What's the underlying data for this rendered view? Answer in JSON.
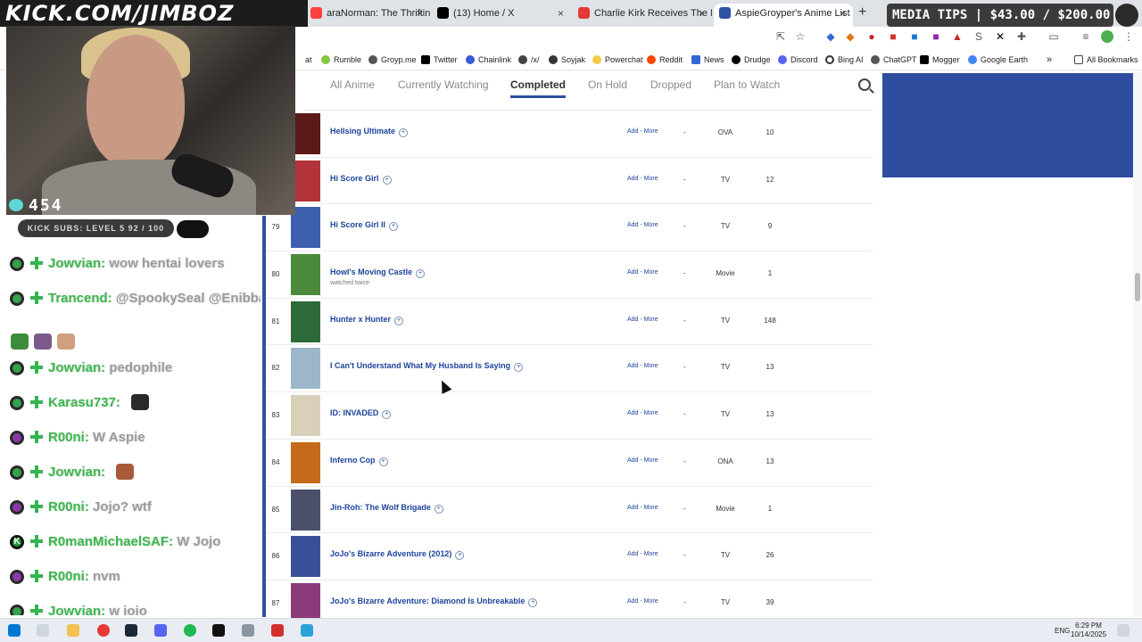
{
  "browser": {
    "tabs": [
      {
        "label": "araNorman: The Thrifting' Of",
        "color": "#ff4040",
        "active": false
      },
      {
        "label": "(13) Home / X",
        "color": "#000000",
        "active": false
      },
      {
        "label": "Charlie Kirk Receives The M",
        "color": "#e53935",
        "active": false
      },
      {
        "label": "AspieGroyper's Anime List - My",
        "color": "#2e51a2",
        "active": true
      }
    ],
    "new_tab": "+",
    "bookmarks": [
      "at",
      "Rumble",
      "Groyp.me",
      "Twitter",
      "Chainlink",
      "/x/",
      "Soyjak",
      "Powerchat",
      "Reddit",
      "News",
      "Drudge",
      "Discord",
      "Bing AI",
      "ChatGPT",
      "Mogger",
      "Google Earth",
      "»",
      "All Bookmarks"
    ]
  },
  "overlay": {
    "banner": "KICK.COM/JIMBOZ",
    "viewers": "454",
    "subs": "KICK SUBS: LEVEL 5 92 / 100",
    "media_tips": "MEDIA TIPS | $43.00 / $200.00"
  },
  "mal": {
    "tabs": [
      "All Anime",
      "Currently Watching",
      "Completed",
      "On Hold",
      "Dropped",
      "Plan to Watch"
    ],
    "active_tab": "Completed",
    "add_more": "Add - More",
    "rows": [
      {
        "num": "",
        "title": "Hellsing Ultimate",
        "note": "",
        "score": "-",
        "type": "OVA",
        "progress": "10",
        "color": "#5a1a1a"
      },
      {
        "num": "",
        "title": "Hi Score Girl",
        "note": "",
        "score": "-",
        "type": "TV",
        "progress": "12",
        "color": "#b3333a"
      },
      {
        "num": "79",
        "title": "Hi Score Girl II",
        "note": "",
        "score": "-",
        "type": "TV",
        "progress": "9",
        "color": "#3e5fb0"
      },
      {
        "num": "80",
        "title": "Howl's Moving Castle",
        "note": "watched twice",
        "score": "-",
        "type": "Movie",
        "progress": "1",
        "color": "#4a8a3a"
      },
      {
        "num": "81",
        "title": "Hunter x Hunter",
        "note": "",
        "score": "-",
        "type": "TV",
        "progress": "148",
        "color": "#2d6a3a"
      },
      {
        "num": "82",
        "title": "I Can't Understand What My Husband Is Saying",
        "note": "",
        "score": "-",
        "type": "TV",
        "progress": "13",
        "color": "#9bb7c9"
      },
      {
        "num": "83",
        "title": "ID: INVADED",
        "note": "",
        "score": "-",
        "type": "TV",
        "progress": "13",
        "color": "#d8d0b8"
      },
      {
        "num": "84",
        "title": "Inferno Cop",
        "note": "",
        "score": "-",
        "type": "ONA",
        "progress": "13",
        "color": "#c46a1a"
      },
      {
        "num": "85",
        "title": "Jin-Roh: The Wolf Brigade",
        "note": "",
        "score": "-",
        "type": "Movie",
        "progress": "1",
        "color": "#4a4f6a"
      },
      {
        "num": "86",
        "title": "JoJo's Bizarre Adventure (2012)",
        "note": "",
        "score": "-",
        "type": "TV",
        "progress": "26",
        "color": "#3a4f9a"
      },
      {
        "num": "87",
        "title": "JoJo's Bizarre Adventure: Diamond Is Unbreakable",
        "note": "",
        "score": "-",
        "type": "TV",
        "progress": "39",
        "color": "#8a3a7a"
      }
    ]
  },
  "chat": [
    {
      "user": "Jowvian:",
      "text": "wow hentai lovers",
      "badge": "green"
    },
    {
      "user": "Trancend:",
      "text": "@SpookySeal @Enibba",
      "badge": "green"
    },
    {
      "user": "",
      "text": "",
      "badge": "none"
    },
    {
      "user": "Jowvian:",
      "text": "pedophile",
      "badge": "green"
    },
    {
      "user": "Karasu737:",
      "text": "",
      "badge": "green"
    },
    {
      "user": "R00ni:",
      "text": "W Aspie",
      "badge": "purple"
    },
    {
      "user": "Jowvian:",
      "text": "",
      "badge": "green"
    },
    {
      "user": "R00ni:",
      "text": "Jojo? wtf",
      "badge": "purple"
    },
    {
      "user": "R0manMichaelSAF:",
      "text": "W Jojo",
      "badge": "k"
    },
    {
      "user": "R00ni:",
      "text": "nvm",
      "badge": "purple"
    },
    {
      "user": "Jowvian:",
      "text": "w jojo",
      "badge": "green"
    }
  ],
  "taskbar": {
    "lang": "ENG",
    "time": "6:29 PM",
    "date": "10/14/2025"
  }
}
